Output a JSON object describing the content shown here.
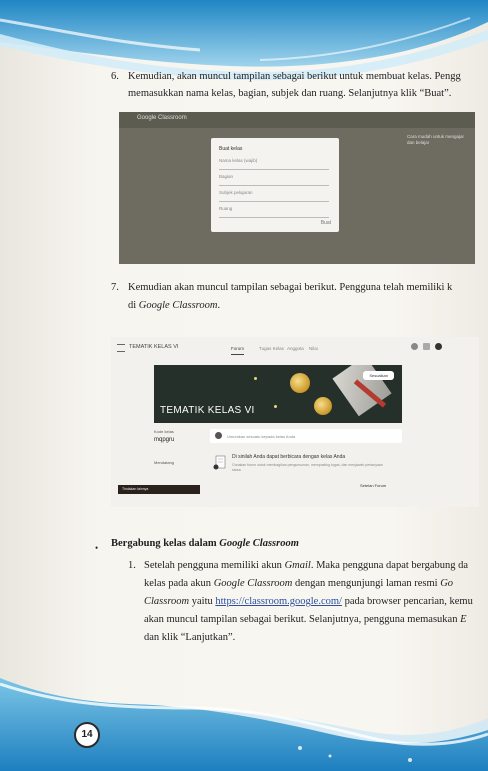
{
  "step6": {
    "number": "6.",
    "line1": "Kemudian, akan muncul tampilan sebagai berikut untuk membuat kelas. Pengg",
    "line2": "memasukkan nama kelas, bagian, subjek dan ruang. Selanjutnya klik “Buat”."
  },
  "screenshot1": {
    "app_title": "Google Classroom",
    "tooltip": "Cara mudah untuk mengajar dan belajar",
    "dialog_title": "Buat kelas",
    "fields": [
      "Nama kelas (wajib)",
      "Bagian",
      "Subjek pelajaran",
      "Ruang"
    ],
    "button": "Buat"
  },
  "step7": {
    "number": "7.",
    "line1": "Kemudian akan muncul tampilan sebagai berikut. Pengguna telah memiliki k",
    "line2_prefix": "di ",
    "line2_italic": "Google Classroom",
    "line2_suffix": "."
  },
  "screenshot2": {
    "class_title": "TEMATIK KELAS VI",
    "tabs": [
      "Forum",
      "Tugas Kelas",
      "Anggota",
      "Nilai"
    ],
    "customize_label": "Sesuaikan",
    "banner_title": "TEMATIK KELAS VI",
    "code_label": "Kode kelas",
    "code_value": "mqpgru",
    "upcoming_label": "Mendatang",
    "post_placeholder": "Umumkan sesuatu kepada kelas Anda",
    "empty_title": "Di sinilah Anda dapat berbicara dengan kelas Anda",
    "empty_body": "Gunakan forum untuk membagikan pengumuman, memposting tugas, dan menjawab pertanyaan siswa",
    "empty_link": "Setelan Forum",
    "bottom_button": "Tindakan lainnya"
  },
  "section": {
    "bullet": "•",
    "heading_plain": "Bergabung kelas dalam ",
    "heading_italic": "Google Classroom"
  },
  "join": {
    "number": "1.",
    "l1_a": "Setelah pengguna memiliki akun ",
    "l1_i": "Gmail",
    "l1_b": ". Maka pengguna dapat bergabung da",
    "l2_a": "kelas pada akun ",
    "l2_i": "Google Classroom",
    "l2_b": " dengan mengunjungi laman resmi ",
    "l2_i2": "Go",
    "l3_i": "Classroom",
    "l3_a": " yaitu ",
    "l3_link": "https://classroom.google.com/",
    "l3_b": " pada browser pencarian, kemu",
    "l4_a": "akan muncul tampilan sebagai berikut. Selanjutnya, pengguna memasukan ",
    "l4_i": "E",
    "l5": "dan klik “Lanjutkan”."
  },
  "page_number": "14",
  "colors": {
    "text": "#1f1f1f",
    "link": "#2d4f9e",
    "wave": "#3a9fd0"
  }
}
